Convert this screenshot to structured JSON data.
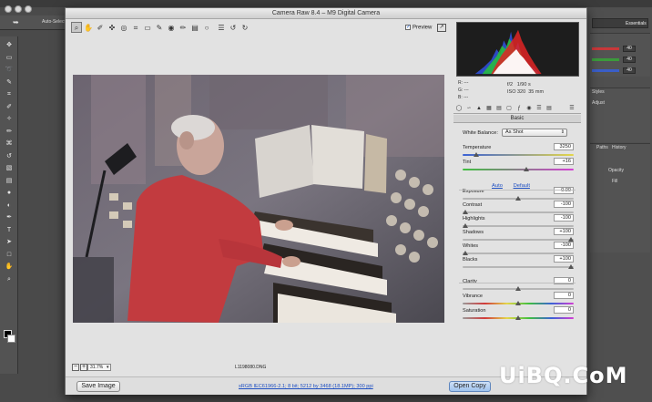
{
  "photoshop": {
    "options_text": "Auto-Select",
    "workspace": "Essentials",
    "panel_values": [
      "40",
      "40",
      "40"
    ],
    "panel_tabs": [
      "Styles",
      "Adjust",
      "Paths",
      "History",
      "Opacity",
      "Fill"
    ],
    "tool_icons": [
      "move-icon",
      "marquee-icon",
      "lasso-icon",
      "quick-select-icon",
      "crop-icon",
      "eyedropper-icon",
      "healing-icon",
      "brush-icon",
      "stamp-icon",
      "history-brush-icon",
      "eraser-icon",
      "gradient-icon",
      "blur-icon",
      "dodge-icon",
      "pen-icon",
      "type-icon",
      "path-select-icon",
      "shape-icon",
      "hand-icon",
      "zoom-icon"
    ]
  },
  "dialog": {
    "title": "Camera Raw 8.4  –  M9 Digital Camera",
    "preview_label": "Preview",
    "preview_checked": true,
    "tools": [
      "zoom-tool-icon",
      "hand-tool-icon",
      "white-balance-icon",
      "color-sampler-icon",
      "targeted-adjust-icon",
      "crop-icon",
      "straighten-icon",
      "spot-removal-icon",
      "red-eye-icon",
      "adjustment-brush-icon",
      "graduated-filter-icon",
      "radial-filter-icon",
      "preferences-icon",
      "rotate-left-icon",
      "rotate-right-icon"
    ]
  },
  "status": {
    "zoom": "31.7%",
    "filename": "L1198080.DNG"
  },
  "bottom": {
    "save_label": "Save Image",
    "workflow": "sRGB IEC61966-2.1; 8 bit; 5212 by 3468 (18.1MP); 300 ppi",
    "open_label": "Open Copy"
  },
  "camera_info": {
    "r_label": "R:",
    "g_label": "G:",
    "b_label": "B:",
    "rgb_value": "---",
    "aperture": "f/2",
    "shutter": "1/90 s",
    "iso": "ISO 320",
    "focal": "35 mm"
  },
  "panel": {
    "name": "Basic",
    "white_balance_label": "White Balance:",
    "white_balance_value": "As Shot",
    "auto_label": "Auto",
    "default_label": "Default",
    "sliders": [
      {
        "label": "Temperature",
        "value": "3250",
        "pos": 0.1
      },
      {
        "label": "Tint",
        "value": "+16",
        "pos": 0.58
      },
      {
        "label": "Exposure",
        "value": "0.00",
        "pos": 0.5
      },
      {
        "label": "Contrast",
        "value": "-100",
        "pos": 0.0
      },
      {
        "label": "Highlights",
        "value": "-100",
        "pos": 0.0
      },
      {
        "label": "Shadows",
        "value": "+100",
        "pos": 1.0
      },
      {
        "label": "Whites",
        "value": "-100",
        "pos": 0.0
      },
      {
        "label": "Blacks",
        "value": "+100",
        "pos": 1.0
      },
      {
        "label": "Clarity",
        "value": "0",
        "pos": 0.5
      },
      {
        "label": "Vibrance",
        "value": "0",
        "pos": 0.5
      },
      {
        "label": "Saturation",
        "value": "0",
        "pos": 0.5
      }
    ]
  },
  "watermark": "UiBQ.CoM"
}
